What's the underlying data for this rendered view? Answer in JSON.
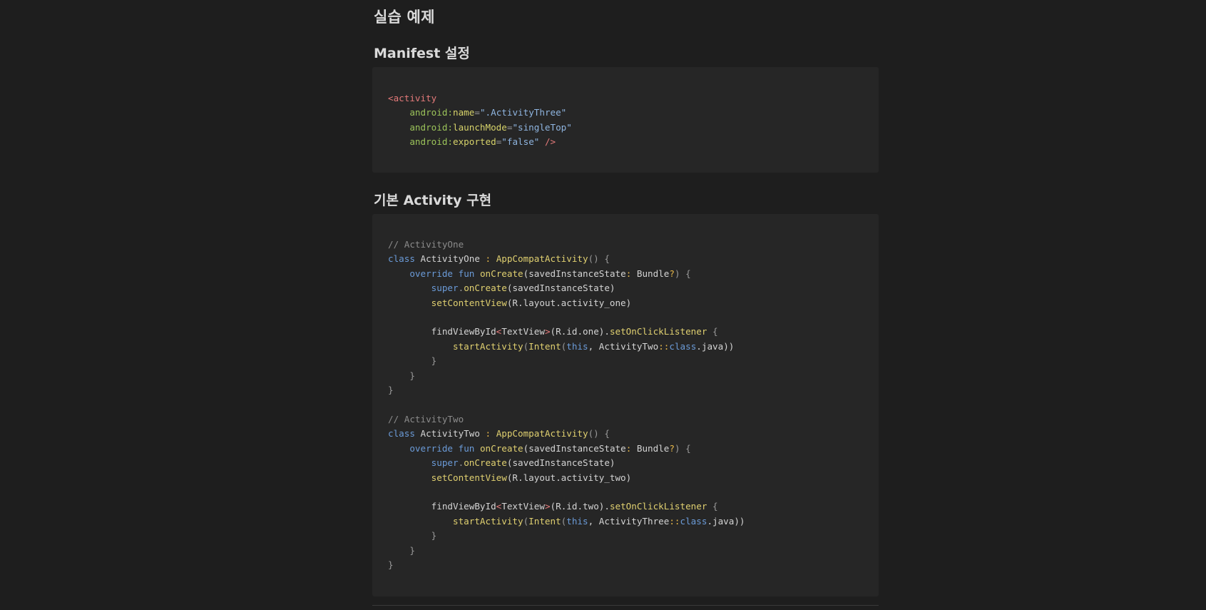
{
  "headings": {
    "main": "실습 예제",
    "manifest": "Manifest 설정",
    "activity": "기본 Activity 구현"
  },
  "manifest_code": [
    [
      {
        "t": "<",
        "c": "tag"
      },
      {
        "t": "activity",
        "c": "tag"
      }
    ],
    [
      {
        "t": "    "
      },
      {
        "t": "android:",
        "c": "ns"
      },
      {
        "t": "name",
        "c": "attr"
      },
      {
        "t": "=",
        "c": "punct"
      },
      {
        "t": "\".ActivityThree\"",
        "c": "str"
      }
    ],
    [
      {
        "t": "    "
      },
      {
        "t": "android:",
        "c": "ns"
      },
      {
        "t": "launchMode",
        "c": "attr"
      },
      {
        "t": "=",
        "c": "punct"
      },
      {
        "t": "\"singleTop\"",
        "c": "str"
      }
    ],
    [
      {
        "t": "    "
      },
      {
        "t": "android:",
        "c": "ns"
      },
      {
        "t": "exported",
        "c": "attr"
      },
      {
        "t": "=",
        "c": "punct"
      },
      {
        "t": "\"false\"",
        "c": "str"
      },
      {
        "t": " />",
        "c": "tag"
      }
    ]
  ],
  "activity_code": [
    [
      {
        "t": "// ActivityOne",
        "c": "comment"
      }
    ],
    [
      {
        "t": "class",
        "c": "kw"
      },
      {
        "t": " ActivityOne ",
        "c": "plain"
      },
      {
        "t": ":",
        "c": "op"
      },
      {
        "t": " "
      },
      {
        "t": "AppCompatActivity",
        "c": "fn"
      },
      {
        "t": "() {",
        "c": "punct"
      }
    ],
    [
      {
        "t": "    "
      },
      {
        "t": "override",
        "c": "kw"
      },
      {
        "t": " "
      },
      {
        "t": "fun",
        "c": "kw"
      },
      {
        "t": " "
      },
      {
        "t": "onCreate",
        "c": "fn"
      },
      {
        "t": "(savedInstanceState",
        "c": "plain"
      },
      {
        "t": ":",
        "c": "op"
      },
      {
        "t": " Bundle",
        "c": "plain"
      },
      {
        "t": "?",
        "c": "op"
      },
      {
        "t": ") {",
        "c": "punct"
      }
    ],
    [
      {
        "t": "        "
      },
      {
        "t": "super",
        "c": "kw"
      },
      {
        "t": ".",
        "c": "punct"
      },
      {
        "t": "onCreate",
        "c": "fn"
      },
      {
        "t": "(savedInstanceState)",
        "c": "plain"
      }
    ],
    [
      {
        "t": "        "
      },
      {
        "t": "setContentView",
        "c": "fn"
      },
      {
        "t": "(R.layout.activity_one)",
        "c": "plain"
      }
    ],
    [
      {
        "t": ""
      }
    ],
    [
      {
        "t": "        "
      },
      {
        "t": "findViewById",
        "c": "plain"
      },
      {
        "t": "<",
        "c": "tag"
      },
      {
        "t": "TextView",
        "c": "plain"
      },
      {
        "t": ">",
        "c": "tag"
      },
      {
        "t": "(R.id.one).",
        "c": "plain"
      },
      {
        "t": "setOnClickListener",
        "c": "fn"
      },
      {
        "t": " {",
        "c": "punct"
      }
    ],
    [
      {
        "t": "            "
      },
      {
        "t": "startActivity",
        "c": "fn"
      },
      {
        "t": "(",
        "c": "punct"
      },
      {
        "t": "Intent",
        "c": "fn"
      },
      {
        "t": "(",
        "c": "punct"
      },
      {
        "t": "this",
        "c": "kw"
      },
      {
        "t": ", ActivityTwo",
        "c": "plain"
      },
      {
        "t": "::",
        "c": "op"
      },
      {
        "t": "class",
        "c": "kw"
      },
      {
        "t": ".java))",
        "c": "plain"
      }
    ],
    [
      {
        "t": "        }",
        "c": "punct"
      }
    ],
    [
      {
        "t": "    }",
        "c": "punct"
      }
    ],
    [
      {
        "t": "}",
        "c": "punct"
      }
    ],
    [
      {
        "t": ""
      }
    ],
    [
      {
        "t": "// ActivityTwo",
        "c": "comment"
      }
    ],
    [
      {
        "t": "class",
        "c": "kw"
      },
      {
        "t": " ActivityTwo ",
        "c": "plain"
      },
      {
        "t": ":",
        "c": "op"
      },
      {
        "t": " "
      },
      {
        "t": "AppCompatActivity",
        "c": "fn"
      },
      {
        "t": "() {",
        "c": "punct"
      }
    ],
    [
      {
        "t": "    "
      },
      {
        "t": "override",
        "c": "kw"
      },
      {
        "t": " "
      },
      {
        "t": "fun",
        "c": "kw"
      },
      {
        "t": " "
      },
      {
        "t": "onCreate",
        "c": "fn"
      },
      {
        "t": "(savedInstanceState",
        "c": "plain"
      },
      {
        "t": ":",
        "c": "op"
      },
      {
        "t": " Bundle",
        "c": "plain"
      },
      {
        "t": "?",
        "c": "op"
      },
      {
        "t": ") {",
        "c": "punct"
      }
    ],
    [
      {
        "t": "        "
      },
      {
        "t": "super",
        "c": "kw"
      },
      {
        "t": ".",
        "c": "punct"
      },
      {
        "t": "onCreate",
        "c": "fn"
      },
      {
        "t": "(savedInstanceState)",
        "c": "plain"
      }
    ],
    [
      {
        "t": "        "
      },
      {
        "t": "setContentView",
        "c": "fn"
      },
      {
        "t": "(R.layout.activity_two)",
        "c": "plain"
      }
    ],
    [
      {
        "t": ""
      }
    ],
    [
      {
        "t": "        "
      },
      {
        "t": "findViewById",
        "c": "plain"
      },
      {
        "t": "<",
        "c": "tag"
      },
      {
        "t": "TextView",
        "c": "plain"
      },
      {
        "t": ">",
        "c": "tag"
      },
      {
        "t": "(R.id.two).",
        "c": "plain"
      },
      {
        "t": "setOnClickListener",
        "c": "fn"
      },
      {
        "t": " {",
        "c": "punct"
      }
    ],
    [
      {
        "t": "            "
      },
      {
        "t": "startActivity",
        "c": "fn"
      },
      {
        "t": "(",
        "c": "punct"
      },
      {
        "t": "Intent",
        "c": "fn"
      },
      {
        "t": "(",
        "c": "punct"
      },
      {
        "t": "this",
        "c": "kw"
      },
      {
        "t": ", ActivityThree",
        "c": "plain"
      },
      {
        "t": "::",
        "c": "op"
      },
      {
        "t": "class",
        "c": "kw"
      },
      {
        "t": ".java))",
        "c": "plain"
      }
    ],
    [
      {
        "t": "        }",
        "c": "punct"
      }
    ],
    [
      {
        "t": "    }",
        "c": "punct"
      }
    ],
    [
      {
        "t": "}",
        "c": "punct"
      }
    ]
  ]
}
